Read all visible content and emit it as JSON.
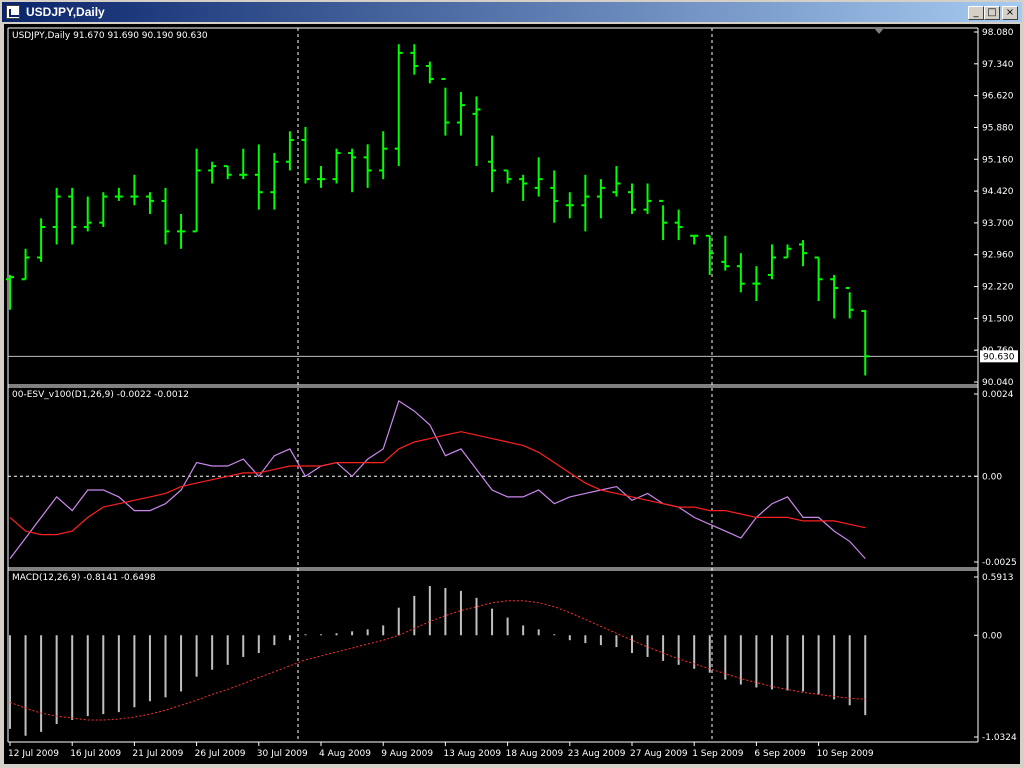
{
  "window": {
    "title": "USDJPY,Daily",
    "buttons": {
      "minimize": "_",
      "maximize": "□",
      "close": "×"
    }
  },
  "chart_data": [
    {
      "type": "ohlc",
      "label": "USDJPY,Daily  91.670 91.690 90.190 90.630",
      "ylim": [
        90.04,
        98.08
      ],
      "yticks": [
        "98.080",
        "97.340",
        "96.620",
        "95.880",
        "95.160",
        "94.420",
        "93.700",
        "92.960",
        "92.220",
        "91.500",
        "90.760",
        "90.040"
      ],
      "current_price": "90.630",
      "colors": {
        "bars": "#00ff00",
        "price_line": "#c0c0c0"
      },
      "bars": [
        [
          92.4,
          92.5,
          91.7,
          92.45
        ],
        [
          92.4,
          93.1,
          92.4,
          92.9
        ],
        [
          92.9,
          93.8,
          92.8,
          93.6
        ],
        [
          93.6,
          94.5,
          93.2,
          94.3
        ],
        [
          94.3,
          94.5,
          93.2,
          93.6
        ],
        [
          93.6,
          94.3,
          93.5,
          93.7
        ],
        [
          93.7,
          94.4,
          93.6,
          94.3
        ],
        [
          94.3,
          94.5,
          94.2,
          94.3
        ],
        [
          94.3,
          94.8,
          94.1,
          94.3
        ],
        [
          94.3,
          94.4,
          93.9,
          94.2
        ],
        [
          94.2,
          94.5,
          93.2,
          93.5
        ],
        [
          93.5,
          93.9,
          93.1,
          93.5
        ],
        [
          93.5,
          95.4,
          93.5,
          94.9
        ],
        [
          94.9,
          95.1,
          94.6,
          95.0
        ],
        [
          95.0,
          95.0,
          94.7,
          94.8
        ],
        [
          94.8,
          95.4,
          94.7,
          94.8
        ],
        [
          94.8,
          95.5,
          94.0,
          94.4
        ],
        [
          94.4,
          95.3,
          94.0,
          95.1
        ],
        [
          95.1,
          95.8,
          94.9,
          95.6
        ],
        [
          95.6,
          95.9,
          94.6,
          94.7
        ],
        [
          94.7,
          95.0,
          94.5,
          94.7
        ],
        [
          94.7,
          95.4,
          94.6,
          95.3
        ],
        [
          95.3,
          95.4,
          94.4,
          95.2
        ],
        [
          95.2,
          95.5,
          94.5,
          94.9
        ],
        [
          94.9,
          95.8,
          94.7,
          95.4
        ],
        [
          95.4,
          97.8,
          95.0,
          97.6
        ],
        [
          97.6,
          97.8,
          97.1,
          97.3
        ],
        [
          97.3,
          97.4,
          96.9,
          97.0
        ],
        [
          97.0,
          96.8,
          95.7,
          96.0
        ],
        [
          96.0,
          96.7,
          95.7,
          96.4
        ],
        [
          96.2,
          96.6,
          95.0,
          96.3
        ],
        [
          95.1,
          95.7,
          94.4,
          94.9
        ],
        [
          94.9,
          94.9,
          94.6,
          94.7
        ],
        [
          94.7,
          94.8,
          94.2,
          94.6
        ],
        [
          94.5,
          95.2,
          94.3,
          94.7
        ],
        [
          94.5,
          94.9,
          93.7,
          94.2
        ],
        [
          94.1,
          94.4,
          93.8,
          94.1
        ],
        [
          94.1,
          94.8,
          93.5,
          94.3
        ],
        [
          94.3,
          94.7,
          93.8,
          94.5
        ],
        [
          94.4,
          95.0,
          94.3,
          94.6
        ],
        [
          94.4,
          94.6,
          93.9,
          94.0
        ],
        [
          94.0,
          94.6,
          93.9,
          94.2
        ],
        [
          94.2,
          94.1,
          93.3,
          93.7
        ],
        [
          93.7,
          94.0,
          93.3,
          93.6
        ],
        [
          93.4,
          93.4,
          93.2,
          93.4
        ],
        [
          93.4,
          93.4,
          92.5,
          93.0
        ],
        [
          92.8,
          93.4,
          92.6,
          92.7
        ],
        [
          92.7,
          93.0,
          92.1,
          92.3
        ],
        [
          92.3,
          92.7,
          91.9,
          92.3
        ],
        [
          92.5,
          93.2,
          92.4,
          92.9
        ],
        [
          92.9,
          93.2,
          92.9,
          93.1
        ],
        [
          93.2,
          93.3,
          92.7,
          93.0
        ],
        [
          92.9,
          92.9,
          91.9,
          92.4
        ],
        [
          92.4,
          92.5,
          91.5,
          92.2
        ],
        [
          92.2,
          92.1,
          91.5,
          91.7
        ],
        [
          91.67,
          91.69,
          90.19,
          90.63
        ]
      ],
      "x_labels": [
        "12 Jul 2009",
        "16 Jul 2009",
        "21 Jul 2009",
        "26 Jul 2009",
        "30 Jul 2009",
        "4 Aug 2009",
        "9 Aug 2009",
        "13 Aug 2009",
        "18 Aug 2009",
        "23 Aug 2009",
        "27 Aug 2009",
        "1 Sep 2009",
        "6 Sep 2009",
        "10 Sep 2009"
      ],
      "vlines": [
        "30 Jul 2009",
        "1 Sep 2009"
      ]
    },
    {
      "type": "line",
      "label": "00-ESV_v100(D1,26,9) -0.0022 -0.0012",
      "ylim": [
        -0.0025,
        0.0024
      ],
      "yticks": [
        "0.0024",
        "0.00",
        "-0.0025"
      ],
      "zero_line": 0.0,
      "series": [
        {
          "name": "main",
          "color": "#cc88ee",
          "values": [
            -0.0024,
            -0.0018,
            -0.0012,
            -0.0006,
            -0.001,
            -0.0004,
            -0.0004,
            -0.0006,
            -0.001,
            -0.001,
            -0.0008,
            -0.0004,
            0.0004,
            0.0003,
            0.0003,
            0.0005,
            0.0,
            0.0006,
            0.0008,
            0.0,
            0.0003,
            0.0004,
            0.0,
            0.0005,
            0.0008,
            0.0022,
            0.0019,
            0.0015,
            0.0006,
            0.0008,
            0.0002,
            -0.0004,
            -0.0006,
            -0.0006,
            -0.0004,
            -0.0008,
            -0.0006,
            -0.0005,
            -0.0004,
            -0.0003,
            -0.0007,
            -0.0005,
            -0.0008,
            -0.0009,
            -0.0012,
            -0.0014,
            -0.0016,
            -0.0018,
            -0.0012,
            -0.0008,
            -0.0006,
            -0.0012,
            -0.0012,
            -0.0016,
            -0.0019,
            -0.0024
          ]
        },
        {
          "name": "signal",
          "color": "#ff2020",
          "values": [
            -0.0012,
            -0.0016,
            -0.0017,
            -0.0017,
            -0.0016,
            -0.0012,
            -0.0009,
            -0.0008,
            -0.0007,
            -0.0006,
            -0.0005,
            -0.0003,
            -0.0002,
            -0.0001,
            0.0,
            0.0001,
            0.0001,
            0.0002,
            0.0003,
            0.0003,
            0.0003,
            0.0004,
            0.0004,
            0.0004,
            0.0004,
            0.0008,
            0.001,
            0.0011,
            0.0012,
            0.0013,
            0.0012,
            0.0011,
            0.001,
            0.0009,
            0.0007,
            0.0004,
            0.0001,
            -0.0002,
            -0.0004,
            -0.0005,
            -0.0006,
            -0.0007,
            -0.0008,
            -0.0009,
            -0.0009,
            -0.001,
            -0.001,
            -0.0011,
            -0.0012,
            -0.0012,
            -0.0012,
            -0.0013,
            -0.0013,
            -0.0013,
            -0.0014,
            -0.0015
          ]
        }
      ]
    },
    {
      "type": "bar",
      "label": "MACD(12,26,9) -0.8141 -0.6498",
      "ylim": [
        -1.0324,
        0.5913
      ],
      "yticks": [
        "0.5913",
        "0.00",
        "-1.0324"
      ],
      "series": [
        {
          "name": "histogram",
          "color": "#c0c0c0",
          "values": [
            -0.95,
            -1.02,
            -0.98,
            -0.9,
            -0.86,
            -0.82,
            -0.8,
            -0.78,
            -0.73,
            -0.67,
            -0.63,
            -0.57,
            -0.42,
            -0.35,
            -0.3,
            -0.22,
            -0.18,
            -0.1,
            -0.05,
            0.0,
            0.0,
            0.02,
            0.04,
            0.06,
            0.1,
            0.28,
            0.4,
            0.5,
            0.48,
            0.45,
            0.38,
            0.27,
            0.18,
            0.1,
            0.06,
            0.0,
            -0.05,
            -0.08,
            -0.1,
            -0.12,
            -0.18,
            -0.22,
            -0.26,
            -0.3,
            -0.34,
            -0.38,
            -0.45,
            -0.5,
            -0.53,
            -0.55,
            -0.56,
            -0.57,
            -0.6,
            -0.65,
            -0.71,
            -0.81
          ]
        },
        {
          "name": "signal",
          "color": "#ff3030",
          "values": [
            -0.68,
            -0.74,
            -0.79,
            -0.82,
            -0.84,
            -0.86,
            -0.86,
            -0.85,
            -0.83,
            -0.8,
            -0.76,
            -0.71,
            -0.66,
            -0.6,
            -0.55,
            -0.49,
            -0.43,
            -0.37,
            -0.31,
            -0.25,
            -0.21,
            -0.17,
            -0.13,
            -0.09,
            -0.05,
            0.0,
            0.07,
            0.14,
            0.2,
            0.25,
            0.29,
            0.33,
            0.35,
            0.35,
            0.33,
            0.29,
            0.23,
            0.16,
            0.09,
            0.02,
            -0.05,
            -0.12,
            -0.18,
            -0.24,
            -0.29,
            -0.34,
            -0.39,
            -0.44,
            -0.48,
            -0.52,
            -0.55,
            -0.58,
            -0.6,
            -0.62,
            -0.64,
            -0.65
          ]
        }
      ]
    }
  ]
}
